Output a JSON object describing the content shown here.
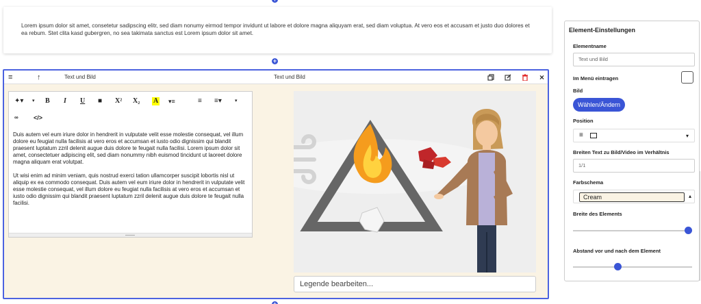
{
  "top_block": {
    "text": "Lorem ipsum dolor sit amet, consetetur sadipscing elitr, sed diam nonumy eirmod tempor invidunt ut labore et dolore magna aliquyam erat, sed diam voluptua. At vero eos et accusam et justo duo dolores et ea rebum. Stet clita kasd gubergren, no sea takimata sanctus est Lorem ipsum dolor sit amet."
  },
  "element_toolbar": {
    "left_title": "Text und Bild",
    "center_title": "Text und Bild"
  },
  "editor": {
    "paragraph1": "Duis autem vel eum iriure dolor in hendrerit in vulputate velit esse molestie consequat, vel illum dolore eu feugiat nulla facilisis at vero eros et accumsan et iusto odio dignissim qui blandit praesent luptatum zzril delenit augue duis dolore te feugait nulla facilisi. Lorem ipsum dolor sit amet, consectetuer adipiscing elit, sed diam nonummy nibh euismod tincidunt ut laoreet dolore magna aliquam erat volutpat.",
    "paragraph2": "Ut wisi enim ad minim veniam, quis nostrud exerci tation ullamcorper suscipit lobortis nisl ut aliquip ex ea commodo consequat. Duis autem vel eum iriure dolor in hendrerit in vulputate velit esse molestie consequat, vel illum dolore eu feugiat nulla facilisis at vero eros et accumsan et iusto odio dignissim qui blandit praesent luptatum zzril delenit augue duis dolore te feugait nulla facilisi.",
    "tools": {
      "bold": "B",
      "italic": "I",
      "underline": "U",
      "superscript": "X²",
      "subscript": "X₂",
      "font_color": "A",
      "link": "⊂⊃",
      "code": "</>"
    }
  },
  "image": {
    "caption_placeholder": "Legende bearbeiten..."
  },
  "panel": {
    "title": "Element-Einstellungen",
    "name_label": "Elementname",
    "name_value": "Text und Bild",
    "menu_label": "Im Menü eintragen",
    "menu_checked": false,
    "image_label": "Bild",
    "image_button": "Wählen/Ändern",
    "position_label": "Position",
    "ratio_label": "Breiten Text zu Bild/Video im Verhältnis",
    "ratio_value": "1/1",
    "scheme_label": "Farbschema",
    "scheme_value": "Cream",
    "width_label": "Breite des Elements",
    "width_value": 1.0,
    "spacing_label": "Abstand vor und nach dem Element",
    "spacing_value": 0.37
  },
  "colors": {
    "accent": "#3a55d6",
    "cream": "#faf3e4",
    "delete": "#e02020"
  }
}
